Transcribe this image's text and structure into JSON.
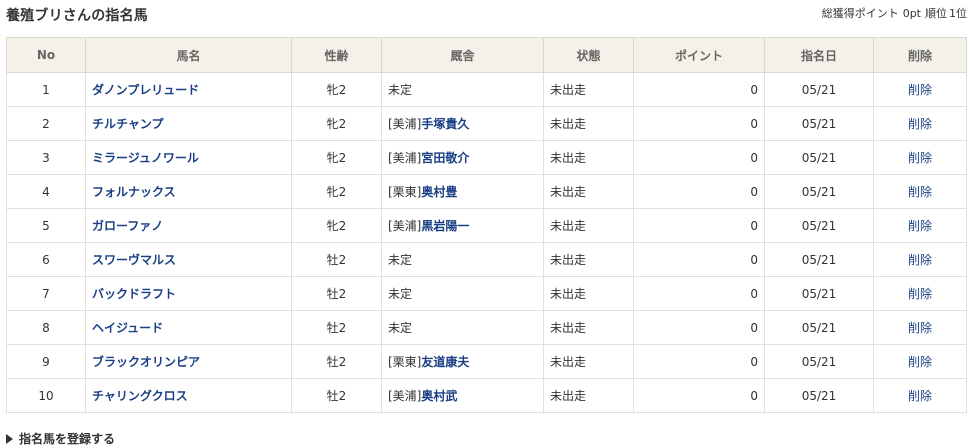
{
  "header": {
    "title": "養殖ブリさんの指名馬",
    "points_label": "総獲得ポイント",
    "points_value": "0pt",
    "rank_label": "順位",
    "rank_value": "1位"
  },
  "table": {
    "columns": [
      "No",
      "馬名",
      "性齢",
      "厩舎",
      "状態",
      "ポイント",
      "指名日",
      "削除"
    ],
    "rows": [
      {
        "no": "1",
        "name": "ダノンプレリュード",
        "sex_age": "牝2",
        "stable_prefix": "未定",
        "trainer": "",
        "status": "未出走",
        "points": "0",
        "date": "05/21",
        "delete": "削除"
      },
      {
        "no": "2",
        "name": "チルチャンプ",
        "sex_age": "牝2",
        "stable_prefix": "[美浦]",
        "trainer": "手塚貴久",
        "status": "未出走",
        "points": "0",
        "date": "05/21",
        "delete": "削除"
      },
      {
        "no": "3",
        "name": "ミラージュノワール",
        "sex_age": "牝2",
        "stable_prefix": "[美浦]",
        "trainer": "宮田敬介",
        "status": "未出走",
        "points": "0",
        "date": "05/21",
        "delete": "削除"
      },
      {
        "no": "4",
        "name": "フォルナックス",
        "sex_age": "牝2",
        "stable_prefix": "[栗東]",
        "trainer": "奥村豊",
        "status": "未出走",
        "points": "0",
        "date": "05/21",
        "delete": "削除"
      },
      {
        "no": "5",
        "name": "ガローファノ",
        "sex_age": "牝2",
        "stable_prefix": "[美浦]",
        "trainer": "黒岩陽一",
        "status": "未出走",
        "points": "0",
        "date": "05/21",
        "delete": "削除"
      },
      {
        "no": "6",
        "name": "スワーヴマルス",
        "sex_age": "牡2",
        "stable_prefix": "未定",
        "trainer": "",
        "status": "未出走",
        "points": "0",
        "date": "05/21",
        "delete": "削除"
      },
      {
        "no": "7",
        "name": "バックドラフト",
        "sex_age": "牡2",
        "stable_prefix": "未定",
        "trainer": "",
        "status": "未出走",
        "points": "0",
        "date": "05/21",
        "delete": "削除"
      },
      {
        "no": "8",
        "name": "ヘイジュード",
        "sex_age": "牡2",
        "stable_prefix": "未定",
        "trainer": "",
        "status": "未出走",
        "points": "0",
        "date": "05/21",
        "delete": "削除"
      },
      {
        "no": "9",
        "name": "ブラックオリンピア",
        "sex_age": "牡2",
        "stable_prefix": "[栗東]",
        "trainer": "友道康夫",
        "status": "未出走",
        "points": "0",
        "date": "05/21",
        "delete": "削除"
      },
      {
        "no": "10",
        "name": "チャリングクロス",
        "sex_age": "牡2",
        "stable_prefix": "[美浦]",
        "trainer": "奥村武",
        "status": "未出走",
        "points": "0",
        "date": "05/21",
        "delete": "削除"
      }
    ]
  },
  "footer": {
    "register_label": "指名馬を登録する"
  },
  "colors": {
    "link": "#1a3f84",
    "header_bg": "#f4f1e8",
    "border": "#ddd8cb"
  }
}
